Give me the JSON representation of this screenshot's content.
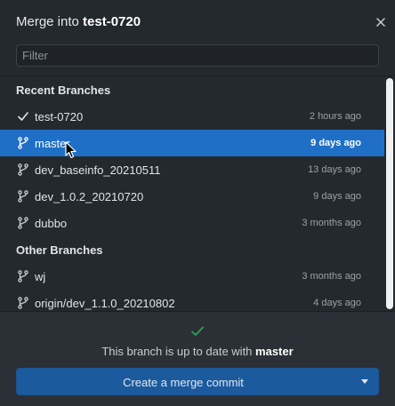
{
  "header": {
    "title_prefix": "Merge into ",
    "title_branch": "test-0720"
  },
  "filter": {
    "placeholder": "Filter",
    "value": ""
  },
  "sections": {
    "recent": "Recent Branches",
    "other": "Other Branches"
  },
  "recent_branches": [
    {
      "name": "test-0720",
      "time": "2 hours ago",
      "icon": "check-icon"
    },
    {
      "name": "master",
      "time": "9 days ago",
      "icon": "branch-icon",
      "selected": true
    },
    {
      "name": "dev_baseinfo_20210511",
      "time": "13 days ago",
      "icon": "branch-icon"
    },
    {
      "name": "dev_1.0.2_20210720",
      "time": "9 days ago",
      "icon": "branch-icon"
    },
    {
      "name": "dubbo",
      "time": "3 months ago",
      "icon": "branch-icon"
    }
  ],
  "other_branches": [
    {
      "name": "wj",
      "time": "3 months ago",
      "icon": "branch-icon"
    },
    {
      "name": "origin/dev_1.1.0_20210802",
      "time": "4 days ago",
      "icon": "branch-icon"
    }
  ],
  "footer": {
    "status_prefix": "This branch is up to date with ",
    "status_branch": "master",
    "merge_button": "Create a merge commit"
  },
  "colors": {
    "background": "#24292e",
    "selected_row": "#1f6fc7",
    "merge_button": "#1c5a9e",
    "success_check": "#2ea44f"
  }
}
